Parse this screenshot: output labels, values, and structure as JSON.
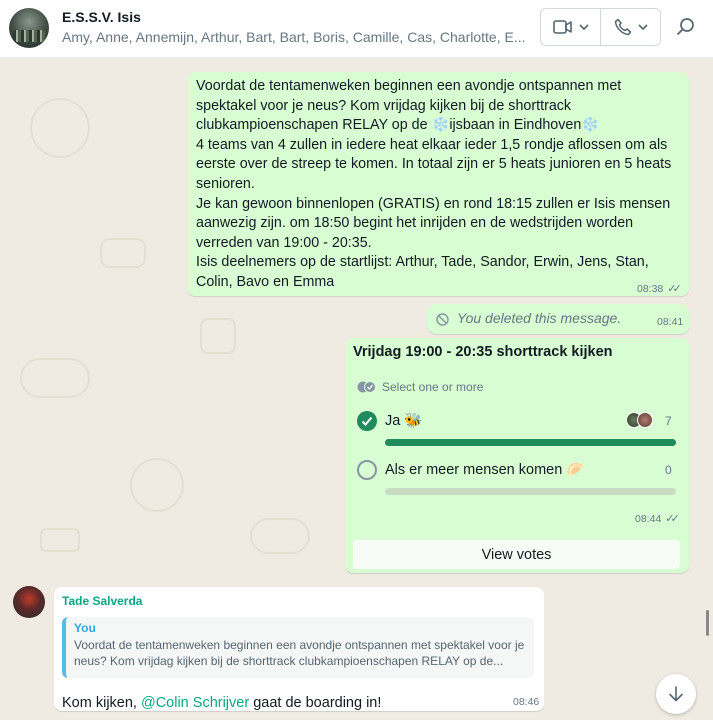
{
  "header": {
    "title": "E.S.S.V. Isis",
    "members": "Amy, Anne, Annemijn, Arthur, Bart, Bart, Boris, Camille, Cas, Charlotte, E..."
  },
  "messages": {
    "announcement": {
      "text": "Voordat de tentamenweken beginnen een avondje ontspannen met\nspektakel voor je neus? Kom vrijdag kijken bij de shorttrack\nclubkampioenschapen RELAY op de ❄️ijsbaan in Eindhoven❄️\n4 teams van 4 zullen in iedere heat elkaar ieder 1,5 rondje aflossen om als\neerste over de streep te komen. In totaal zijn er 5 heats junioren en 5 heats\nsenioren.\nJe kan gewoon binnenlopen (GRATIS) en rond 18:15 zullen er Isis mensen\naanwezig zijn. om 18:50 begint het inrijden en de wedstrijden worden\nverreden van 19:00 - 20:35.\nIsis deelnemers op de startlijst: Arthur, Tade, Sandor, Erwin, Jens, Stan,\nColin, Bavo en Emma",
      "time": "08:38"
    },
    "deleted": {
      "text": "You deleted this message.",
      "time": "08:41"
    },
    "poll": {
      "title": "Vrijdag 19:00 - 20:35 shorttrack kijken",
      "hint": "Select one or more",
      "options": [
        {
          "label": "Ja 🐝",
          "count": "7",
          "fraction": 1.0,
          "checked": true
        },
        {
          "label": "Als er meer mensen komen 🥟",
          "count": "0",
          "fraction": 0.0,
          "checked": false
        }
      ],
      "time": "08:44",
      "view_votes": "View votes"
    },
    "reply": {
      "sender": "Tade Salverda",
      "quote_author": "You",
      "quote_text": "Voordat de tentamenweken beginnen een avondje ontspannen met spektakel voor je neus? Kom vrijdag kijken bij de shorttrack clubkampioenschapen RELAY op de...",
      "text_before": "Kom kijken, ",
      "mention": "@Colin Schrijver",
      "text_after": " gaat de boarding in!",
      "time": "08:46"
    }
  },
  "colors": {
    "outgoing_bubble": "#d9fdd3",
    "incoming_bubble": "#ffffff",
    "accent_green": "#1f8a5b",
    "sender_name": "#06a882",
    "quote_author": "#35a6d8"
  },
  "icons": {
    "video": "video-icon",
    "phone": "phone-icon",
    "search": "search-icon",
    "chevron": "chevron-down-icon",
    "blocked": "blocked-icon",
    "scroll_down": "arrow-down-icon"
  }
}
